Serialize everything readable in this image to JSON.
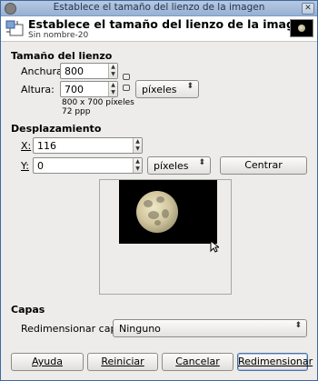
{
  "window": {
    "title": "Establece el tamaño del lienzo de la imagen"
  },
  "header": {
    "title": "Establece el tamaño del lienzo de la imagen",
    "subtitle": "Sin nombre-20"
  },
  "canvas_size": {
    "section_label": "Tamaño del lienzo",
    "width_label": "Anchura:",
    "width_value": "800",
    "height_label": "Altura:",
    "height_value": "700",
    "unit": "píxeles",
    "size_info": "800 x 700 píxeles",
    "resolution_info": "72 ppp"
  },
  "offset": {
    "section_label": "Desplazamiento",
    "x_label": "X:",
    "x_value": "116",
    "y_label": "Y:",
    "y_value": "0",
    "unit": "píxeles",
    "center_button": "Centrar"
  },
  "layers": {
    "section_label": "Capas",
    "resize_label": "Redimensionar capas:",
    "resize_value": "Ninguno"
  },
  "buttons": {
    "help": "Ayuda",
    "reset": "Reiniciar",
    "cancel": "Cancelar",
    "resize": "Redimensionar"
  }
}
